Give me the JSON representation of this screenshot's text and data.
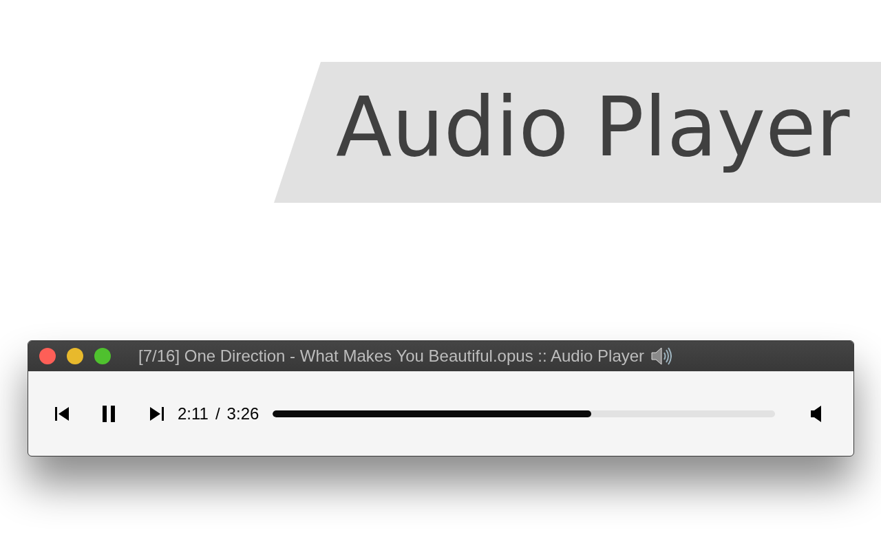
{
  "banner": {
    "title": "Audio Player"
  },
  "window": {
    "title": "[7/16] One Direction - What Makes You Beautiful.opus :: Audio Player"
  },
  "player": {
    "playing": true,
    "elapsed": "2:11",
    "separator": "/",
    "duration": "3:26",
    "progress": {
      "level": 0.634
    }
  }
}
